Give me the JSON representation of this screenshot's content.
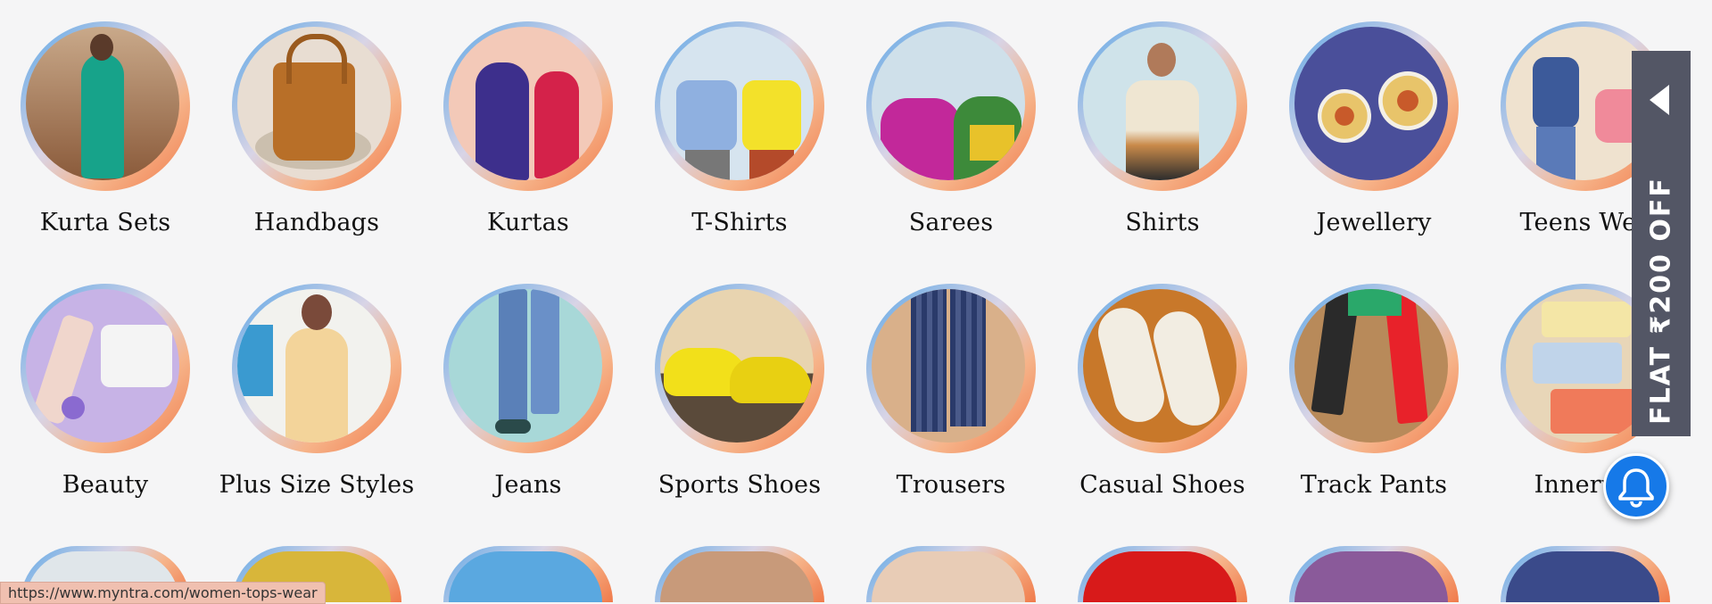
{
  "categories_row1": [
    {
      "label": "Kurta Sets",
      "icon": "kurta-sets-image"
    },
    {
      "label": "Handbags",
      "icon": "handbags-image"
    },
    {
      "label": "Kurtas",
      "icon": "kurtas-image"
    },
    {
      "label": "T-Shirts",
      "icon": "tshirts-image"
    },
    {
      "label": "Sarees",
      "icon": "sarees-image"
    },
    {
      "label": "Shirts",
      "icon": "shirts-image"
    },
    {
      "label": "Jewellery",
      "icon": "jewellery-image"
    },
    {
      "label": "Teens Wea",
      "icon": "teens-wear-image"
    }
  ],
  "categories_row2": [
    {
      "label": "Beauty",
      "icon": "beauty-image"
    },
    {
      "label": "Plus Size Styles",
      "icon": "plus-size-image"
    },
    {
      "label": "Jeans",
      "icon": "jeans-image"
    },
    {
      "label": "Sports Shoes",
      "icon": "sports-shoes-image"
    },
    {
      "label": "Trousers",
      "icon": "trousers-image"
    },
    {
      "label": "Casual Shoes",
      "icon": "casual-shoes-image"
    },
    {
      "label": "Track Pants",
      "icon": "track-pants-image"
    },
    {
      "label": "Innerwe",
      "icon": "innerwear-image"
    }
  ],
  "promo": {
    "text": "FLAT ₹200 OFF",
    "icon": "collapse-arrow-icon"
  },
  "notification": {
    "icon": "bell-icon"
  },
  "status_bar": {
    "url": "https://www.myntra.com/women-tops-wear"
  },
  "colors": {
    "promo_bg": "#535665",
    "bell_bg": "#1679e8",
    "page_bg": "#f5f5f6"
  }
}
